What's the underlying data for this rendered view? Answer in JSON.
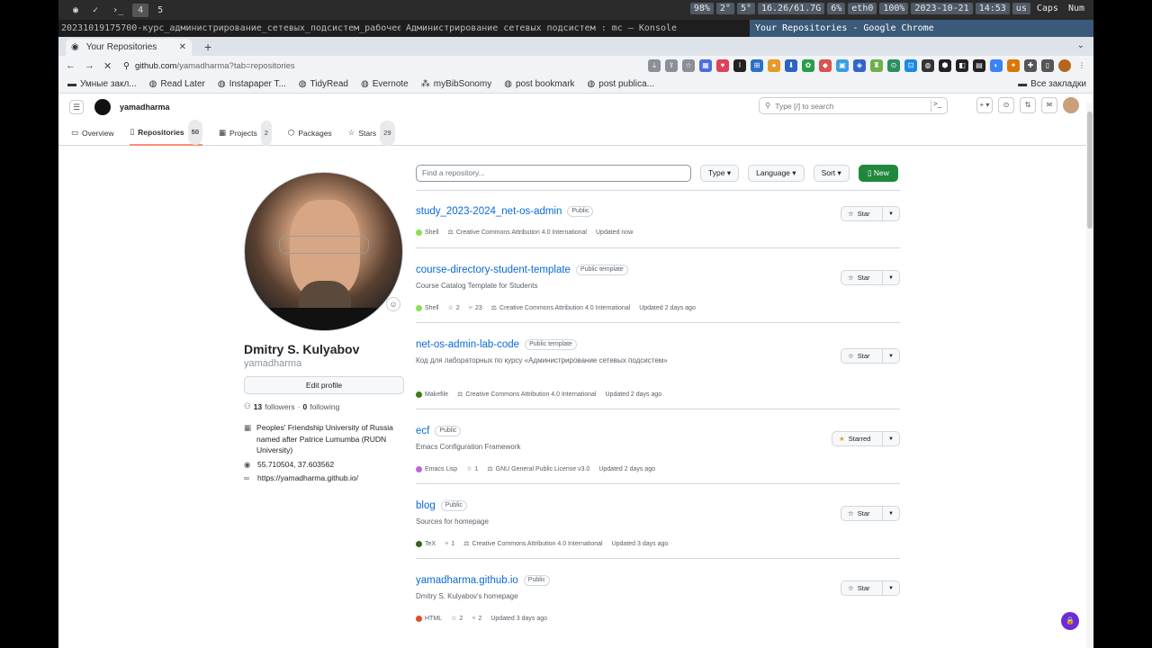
{
  "wm": {
    "workspaces": [
      "4",
      "5"
    ],
    "status": [
      "98%",
      "2°",
      "5°",
      "16.26/61.7G",
      "6%",
      "eth0",
      "100%",
      "2023-10-21",
      "14:53",
      "us",
      "Caps",
      "Num"
    ]
  },
  "titles": {
    "konsole1": "20231019175700-курс_администрирование_сетевых_подсистем_рабочее_пространство_дг",
    "konsole2": "Администрирование сетевых подсистем : mc — Konsole",
    "chrome": "Your Repositories - Google Chrome"
  },
  "browser": {
    "tab_title": "Your Repositories",
    "url_host": "github.com",
    "url_path": "/yamadharma?tab=repositories",
    "bookmarks": [
      "Умные закл...",
      "Read Later",
      "Instapaper T...",
      "TidyRead",
      "Evernote",
      "myBibSonomy",
      "post bookmark",
      "post publica..."
    ],
    "all_bookmarks": "Все закладки"
  },
  "header": {
    "username": "yamadharma",
    "search_placeholder": "Type [/] to search"
  },
  "profile_nav": {
    "overview": "Overview",
    "repositories": "Repositories",
    "repositories_count": "50",
    "projects": "Projects",
    "projects_count": "2",
    "packages": "Packages",
    "stars": "Stars",
    "stars_count": "29"
  },
  "profile": {
    "name": "Dmitry S. Kulyabov",
    "login": "yamadharma",
    "edit_label": "Edit profile",
    "followers_count": "13",
    "followers_label": "followers",
    "following_count": "0",
    "following_label": "following",
    "org": "Peoples' Friendship University of Russia named after Patrice Lumumba (RUDN University)",
    "location": "55.710504, 37.603562",
    "website": "https://yamadharma.github.io/"
  },
  "filters": {
    "find_placeholder": "Find a repository...",
    "type": "Type",
    "language": "Language",
    "sort": "Sort",
    "new": "New"
  },
  "repos": [
    {
      "name": "study_2023-2024_net-os-admin",
      "badge": "Public",
      "desc": "",
      "lang": "Shell",
      "lang_color": "#89e051",
      "stars": "",
      "forks": "",
      "license": "Creative Commons Attribution 4.0 International",
      "updated": "Updated now",
      "star_label": "Star"
    },
    {
      "name": "course-directory-student-template",
      "badge": "Public template",
      "desc": "Course Catalog Template for Students",
      "lang": "Shell",
      "lang_color": "#89e051",
      "stars": "2",
      "forks": "23",
      "license": "Creative Commons Attribution 4.0 International",
      "updated": "Updated 2 days ago",
      "star_label": "Star"
    },
    {
      "name": "net-os-admin-lab-code",
      "badge": "Public template",
      "desc": "Код для лабораторных по курсу «Администрирование сетевых подсистем»",
      "lang": "Makefile",
      "lang_color": "#427819",
      "stars": "",
      "forks": "",
      "license": "Creative Commons Attribution 4.0 International",
      "updated": "Updated 2 days ago",
      "star_label": "Star"
    },
    {
      "name": "ecf",
      "badge": "Public",
      "desc": "Emacs Configuration Framework",
      "lang": "Emacs Lisp",
      "lang_color": "#c065db",
      "stars": "1",
      "forks": "",
      "license": "GNU General Public License v3.0",
      "updated": "Updated 2 days ago",
      "star_label": "Starred"
    },
    {
      "name": "blog",
      "badge": "Public",
      "desc": "Sources for homepage",
      "lang": "TeX",
      "lang_color": "#3d6117",
      "stars": "",
      "forks": "1",
      "license": "Creative Commons Attribution 4.0 International",
      "updated": "Updated 3 days ago",
      "star_label": "Star"
    },
    {
      "name": "yamadharma.github.io",
      "badge": "Public",
      "desc": "Dmitry S. Kulyabov's homepage",
      "lang": "HTML",
      "lang_color": "#e34c26",
      "stars": "2",
      "forks": "2",
      "license": "",
      "updated": "Updated 3 days ago",
      "star_label": "Star"
    }
  ]
}
